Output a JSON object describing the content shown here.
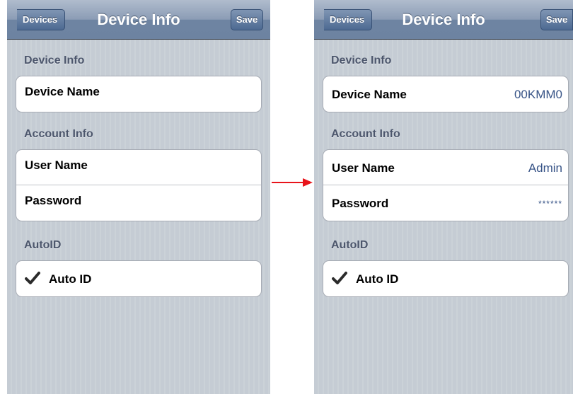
{
  "colors": {
    "nav_tint": "#6d83a1",
    "background": "#c5ccd4",
    "section_header": "#4c566c",
    "value_text": "#385487",
    "arrow": "#e8141b"
  },
  "icons": {
    "checkmark": "check-icon",
    "arrow": "arrow-right-icon"
  },
  "left": {
    "nav": {
      "back_label": "Devices",
      "title": "Device Info",
      "save_label": "Save"
    },
    "sections": {
      "device_header": "Device Info",
      "account_header": "Account Info",
      "autoid_header": "AutoID"
    },
    "rows": {
      "device_name_label": "Device Name",
      "user_name_label": "User Name",
      "password_label": "Password",
      "auto_id_label": "Auto ID"
    }
  },
  "right": {
    "nav": {
      "back_label": "Devices",
      "title": "Device Info",
      "save_label": "Save"
    },
    "sections": {
      "device_header": "Device Info",
      "account_header": "Account Info",
      "autoid_header": "AutoID"
    },
    "rows": {
      "device_name_label": "Device Name",
      "device_name_value": "00KMM0",
      "user_name_label": "User Name",
      "user_name_value": "Admin",
      "password_label": "Password",
      "password_value": "******",
      "auto_id_label": "Auto ID"
    }
  }
}
